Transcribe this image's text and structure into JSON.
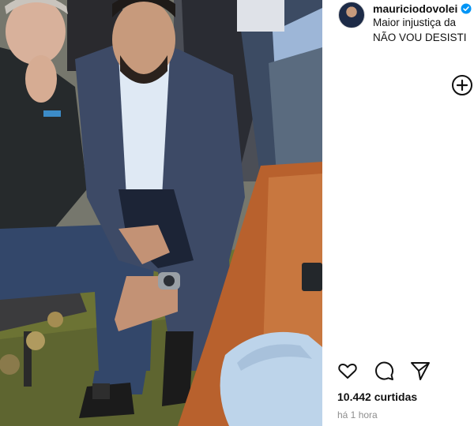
{
  "post": {
    "username": "mauriciodovolei",
    "verified": true,
    "caption_lines": [
      "Maior injustiça da",
      "NÃO VOU DESISTI"
    ],
    "likes_text": "10.442 curtidas",
    "time_text": "há 1 hora"
  },
  "icons": {
    "avatar": "profile-avatar",
    "verified": "verified-badge-icon",
    "add": "plus-circle-icon",
    "like": "heart-icon",
    "comment": "comment-icon",
    "share": "send-icon"
  },
  "colors": {
    "verified_blue": "#0095f6",
    "secondary_text": "#8e8e8e"
  }
}
